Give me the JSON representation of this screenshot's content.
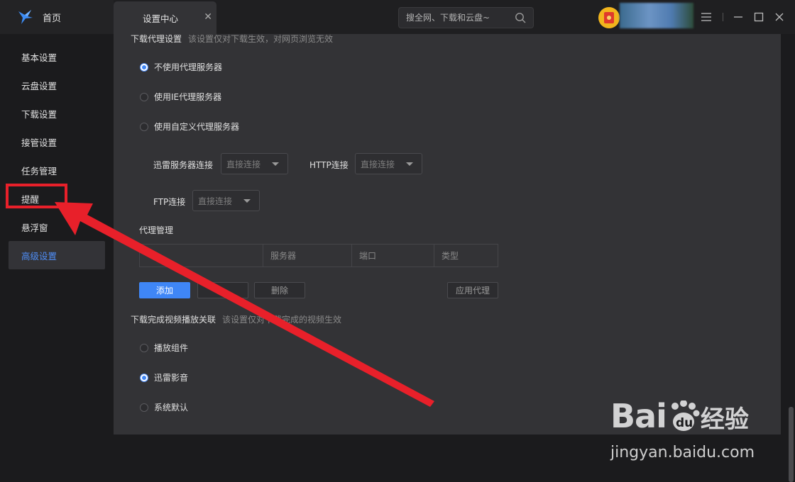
{
  "header": {
    "home_tab": "首页",
    "settings_tab": "设置中心",
    "search_placeholder": "搜全网、下载和云盘~"
  },
  "sidebar": {
    "items": [
      {
        "label": "基本设置"
      },
      {
        "label": "云盘设置"
      },
      {
        "label": "下载设置"
      },
      {
        "label": "接管设置"
      },
      {
        "label": "任务管理"
      },
      {
        "label": "提醒"
      },
      {
        "label": "悬浮窗"
      },
      {
        "label": "高级设置",
        "active": true
      }
    ]
  },
  "proxy": {
    "title": "下载代理设置",
    "hint": "该设置仅对下载生效，对网页浏览无效",
    "options": [
      {
        "label": "不使用代理服务器",
        "selected": true
      },
      {
        "label": "使用IE代理服务器",
        "selected": false
      },
      {
        "label": "使用自定义代理服务器",
        "selected": false
      }
    ],
    "xunlei_label": "迅雷服务器连接",
    "xunlei_value": "直接连接",
    "http_label": "HTTP连接",
    "http_value": "直接连接",
    "ftp_label": "FTP连接",
    "ftp_value": "直接连接",
    "manage_title": "代理管理",
    "table_headers": [
      "",
      "服务器",
      "端口",
      "类型"
    ],
    "buttons": {
      "add": "添加",
      "delete": "删除",
      "apply": "应用代理"
    }
  },
  "video": {
    "title": "下载完成视频播放关联",
    "hint": "该设置仅对下载完成的视频生效",
    "options": [
      {
        "label": "播放组件",
        "selected": false
      },
      {
        "label": "迅雷影音",
        "selected": true
      },
      {
        "label": "系统默认",
        "selected": false
      }
    ]
  },
  "watermark": {
    "brand_latin": "Bai",
    "brand_du": "du",
    "brand_cn": "经验",
    "url": "jingyan.baidu.com"
  },
  "colors": {
    "accent": "#3f86f6",
    "annotation_red": "#e8202a",
    "panel_bg": "#333336",
    "sidebar_bg": "#1b1b1d"
  }
}
